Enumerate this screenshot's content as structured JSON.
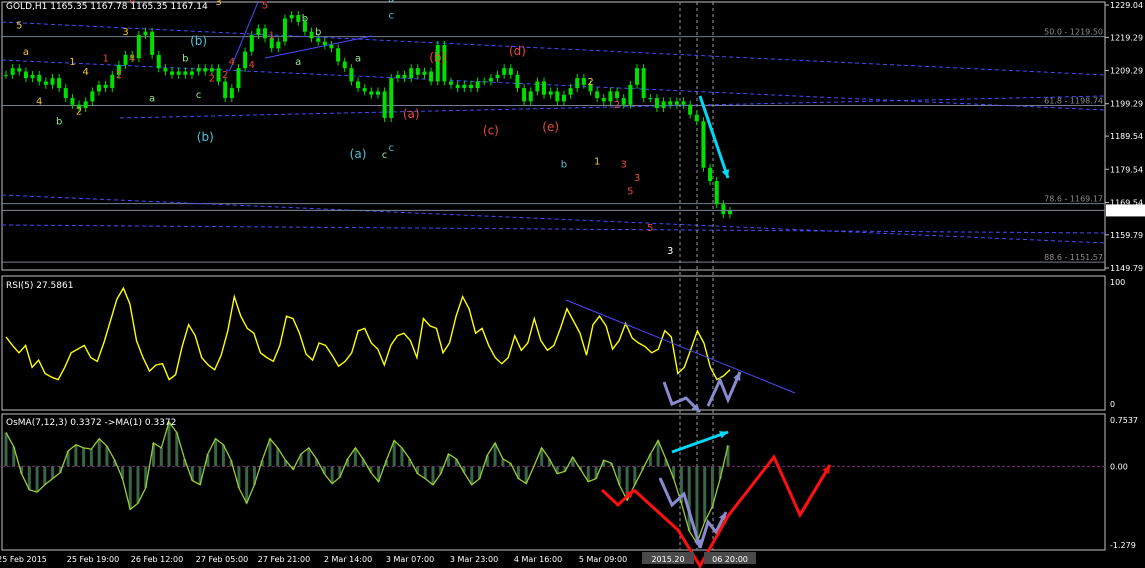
{
  "colors": {
    "background": "#000000",
    "frame": "#c0c0c0",
    "candles": "#00e000",
    "rsi": "#ffff00",
    "osma_hist": "#3a6648",
    "osma_line": "#9acd32",
    "trend": "#4a4aff",
    "fib": "#708090",
    "zero": "#7a2a7a",
    "arrow_cyan": "#00d8f8",
    "arrow_purple": "#8a8ad0",
    "arrow_red": "#ff1010"
  },
  "main": {
    "title": "GOLD,H1  1165.35 1167.78 1165.35 1167.14",
    "price_axis": [
      "1229.04",
      "1219.29",
      "1209.29",
      "1199.29",
      "1189.54",
      "1179.54",
      "1169.54",
      "1159.79",
      "1149.79"
    ],
    "current_price": "1167.14",
    "fib_levels": [
      {
        "label": "50.0 - 1219.50",
        "price": 1219.5
      },
      {
        "label": "61.8 - 1198.74",
        "price": 1198.74
      },
      {
        "label": "78.6 - 1169.17",
        "price": 1169.17
      },
      {
        "label": "88.6 - 1151.57",
        "price": 1151.57
      }
    ],
    "wave_labels": [
      {
        "t": "(c)",
        "c": "#4fc3d8"
      },
      {
        "t": "5",
        "c": "#e84a3a"
      },
      {
        "t": "b",
        "c": "#90ee90"
      },
      {
        "t": "a",
        "c": "#4fc3d8"
      },
      {
        "t": "c",
        "c": "#4fc3d8"
      },
      {
        "t": "a",
        "c": "#90ee90"
      },
      {
        "t": "(b)",
        "c": "#4fc3d8"
      },
      {
        "t": "c",
        "c": "#4fc3d8"
      },
      {
        "t": "(b)",
        "c": "#e84a3a"
      },
      {
        "t": "(d)",
        "c": "#e84a3a"
      },
      {
        "t": "2",
        "c": "#f0c23a"
      },
      {
        "t": "2",
        "c": "#e84a3a"
      },
      {
        "t": "3",
        "c": "#e84a3a"
      },
      {
        "t": "5",
        "c": "#e84a3a"
      },
      {
        "t": "6",
        "c": "#e84a3a"
      },
      {
        "t": "3",
        "c": "#f0c23a"
      },
      {
        "t": "1",
        "c": "#e84a3a"
      },
      {
        "t": "5",
        "c": "#f0c23a"
      },
      {
        "t": "a",
        "c": "#f0c23a"
      },
      {
        "t": "4",
        "c": "#e84a3a"
      },
      {
        "t": "1",
        "c": "#f0c23a"
      },
      {
        "t": "2",
        "c": "#e84a3a"
      },
      {
        "t": "4",
        "c": "#f0c23a"
      },
      {
        "t": "b",
        "c": "#90ee90"
      },
      {
        "t": "3",
        "c": "#f0c23a"
      },
      {
        "t": "2",
        "c": "#e84a3a"
      },
      {
        "t": "4",
        "c": "#e84a3a"
      },
      {
        "t": "4",
        "c": "#f0c23a"
      },
      {
        "t": "b",
        "c": "#90ee90"
      },
      {
        "t": "2",
        "c": "#f0c23a"
      },
      {
        "t": "a",
        "c": "#90ee90"
      },
      {
        "t": "c",
        "c": "#90ee90"
      },
      {
        "t": "2",
        "c": "#e84a3a"
      },
      {
        "t": "4",
        "c": "#e84a3a"
      },
      {
        "t": "a",
        "c": "#90ee90"
      },
      {
        "t": "b",
        "c": "#90ee90"
      },
      {
        "t": "1",
        "c": "#e84a3a"
      },
      {
        "t": "(b)",
        "c": "#4fc3d8"
      },
      {
        "t": "c",
        "c": "#90ee90"
      },
      {
        "t": "(a)",
        "c": "#4fc3d8"
      },
      {
        "t": "(a)",
        "c": "#e84a3a"
      },
      {
        "t": "(c)",
        "c": "#e84a3a"
      },
      {
        "t": "(e)",
        "c": "#e84a3a"
      },
      {
        "t": "b",
        "c": "#4fc3d8"
      },
      {
        "t": "1",
        "c": "#f0c23a"
      },
      {
        "t": "3",
        "c": "#e84a3a"
      },
      {
        "t": "5",
        "c": "#e84a3a"
      },
      {
        "t": "3",
        "c": "#ffffff"
      }
    ]
  },
  "rsi": {
    "title": "RSI(5) 27.5861",
    "axis": [
      "100",
      "0"
    ]
  },
  "osma": {
    "title": "OsMA(7,12,3) 0.3372  ->MA(1) 0.3372",
    "axis": [
      "0.7537",
      "0.00",
      "-1.279"
    ]
  },
  "time_axis": [
    "25 Feb 2015",
    "25 Feb 19:00",
    "26 Feb 12:00",
    "27 Feb 05:00",
    "27 Feb 21:00",
    "2 Mar 14:00",
    "3 Mar 07:00",
    "3 Mar 23:00",
    "4 Mar 16:00",
    "5 Mar 09:00",
    "2015.20",
    "06 20:00"
  ],
  "chart_data": {
    "type": "line",
    "symbol": "GOLD",
    "timeframe": "H1",
    "ohlc_last": {
      "open": 1165.35,
      "high": 1167.78,
      "low": 1165.35,
      "close": 1167.14
    },
    "price_ylim": [
      1149.79,
      1229.04
    ],
    "price_close": [
      1208,
      1210,
      1209,
      1207,
      1208,
      1206,
      1205,
      1207,
      1204,
      1201,
      1199,
      1198,
      1200,
      1203,
      1205,
      1204,
      1208,
      1211,
      1214,
      1213,
      1220,
      1221,
      1214,
      1210,
      1209,
      1208,
      1209,
      1208,
      1209,
      1210,
      1209,
      1210,
      1206,
      1201,
      1204,
      1210,
      1215,
      1220,
      1222,
      1219,
      1216,
      1218,
      1225,
      1226,
      1224,
      1221,
      1219,
      1218,
      1217,
      1216,
      1212,
      1210,
      1206,
      1204,
      1203,
      1202,
      1203,
      1195,
      1207,
      1208,
      1207,
      1210,
      1208,
      1209,
      1206,
      1217,
      1206,
      1205,
      1204,
      1205,
      1204,
      1206,
      1206,
      1207,
      1208,
      1210,
      1208,
      1204,
      1200,
      1203,
      1206,
      1202,
      1203,
      1200,
      1202,
      1204,
      1207,
      1205,
      1203,
      1201,
      1200,
      1203,
      1201,
      1199,
      1205,
      1210,
      1201,
      1201,
      1198,
      1200,
      1199,
      1200,
      1199,
      1196,
      1194,
      1180,
      1176,
      1169,
      1166,
      1167
    ],
    "rsi": {
      "ylim": [
        0,
        100
      ],
      "values": [
        55,
        48,
        42,
        48,
        30,
        36,
        25,
        22,
        20,
        30,
        42,
        45,
        48,
        38,
        35,
        50,
        68,
        86,
        95,
        82,
        52,
        38,
        27,
        32,
        33,
        20,
        24,
        47,
        65,
        56,
        38,
        32,
        28,
        40,
        60,
        88,
        72,
        62,
        58,
        42,
        38,
        35,
        48,
        72,
        70,
        58,
        41,
        36,
        50,
        48,
        40,
        31,
        35,
        42,
        60,
        62,
        50,
        45,
        32,
        48,
        56,
        58,
        52,
        38,
        70,
        64,
        62,
        42,
        50,
        72,
        88,
        78,
        58,
        62,
        48,
        38,
        33,
        38,
        56,
        44,
        50,
        70,
        52,
        44,
        48,
        62,
        78,
        68,
        58,
        40,
        65,
        72,
        64,
        45,
        52,
        66,
        54,
        50,
        47,
        42,
        45,
        60,
        55,
        25,
        30,
        45,
        60,
        50,
        30,
        20,
        23,
        28
      ]
    },
    "osma": {
      "ylim": [
        -1.279,
        0.7537
      ],
      "values": [
        0.55,
        0.32,
        -0.12,
        -0.38,
        -0.42,
        -0.3,
        -0.2,
        -0.1,
        0.25,
        0.35,
        0.3,
        0.28,
        0.45,
        0.33,
        0.1,
        -0.2,
        -0.7,
        -0.6,
        -0.35,
        0.38,
        0.3,
        0.72,
        0.55,
        0.12,
        -0.23,
        -0.3,
        0.2,
        0.45,
        0.35,
        0.1,
        -0.35,
        -0.6,
        -0.3,
        0.1,
        0.45,
        0.3,
        0.1,
        -0.05,
        0.2,
        0.3,
        0.12,
        -0.12,
        -0.28,
        -0.18,
        0.12,
        0.3,
        0.12,
        -0.1,
        -0.25,
        0.1,
        0.42,
        0.3,
        0.12,
        -0.12,
        -0.2,
        -0.3,
        -0.12,
        0.2,
        0.12,
        -0.1,
        -0.3,
        -0.2,
        0.18,
        0.38,
        0.12,
        0.05,
        -0.2,
        -0.28,
        0.0,
        0.3,
        0.12,
        -0.12,
        -0.08,
        0.15,
        -0.05,
        -0.25,
        -0.2,
        0.1,
        0.05,
        -0.3,
        -0.55,
        -0.3,
        -0.05,
        0.2,
        0.42,
        0.12,
        -0.2,
        -0.6,
        -1.05,
        -1.25,
        -0.9,
        -0.65,
        -0.2,
        0.34
      ]
    }
  }
}
